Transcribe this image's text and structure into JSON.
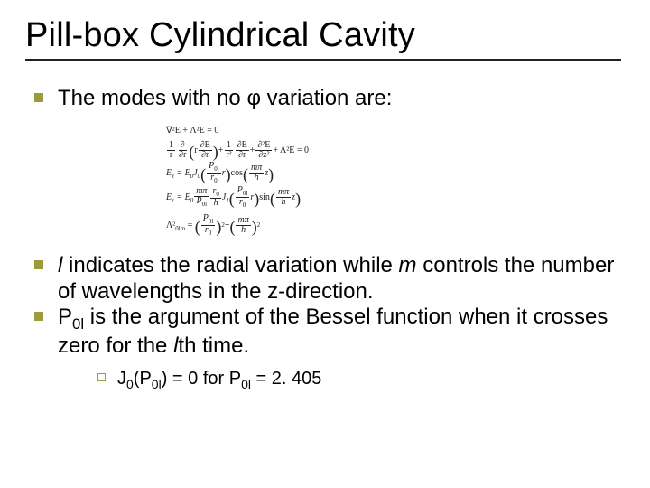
{
  "title": "Pill-box Cylindrical Cavity",
  "bullet1": "The modes with no φ variation are:",
  "equations": {
    "eq1_lhs": "∇²E + Λ²E = 0",
    "eq2": {
      "t1_num": "1",
      "t1_den": "r",
      "t2_num": "∂",
      "t2_den": "∂r",
      "t3_num": "∂E",
      "t3_den": "∂r",
      "t4_num": "1",
      "t4_den": "r²",
      "t5_num": "∂E",
      "t5_den": "∂r",
      "t6_num": "∂²E",
      "t6_den": "∂z²",
      "tail": "+ Λ²E = 0",
      "r_inside": "r"
    },
    "eq3": {
      "lhs": "E",
      "lhs_sub": "z",
      "coef": "= E",
      "coef_sub": "0",
      "J": "J",
      "J_sub": "0",
      "arg1_num": "P",
      "arg1_num_sub": "0l",
      "arg1_den": "r",
      "arg1_den_sub": "0",
      "r_after": "r",
      "trig": "cos",
      "arg2_num": "mπ",
      "arg2_den": "h",
      "z_after": "z"
    },
    "eq4": {
      "lhs": "E",
      "lhs_sub": "r",
      "eqs": "= E",
      "eqs_sub": "0",
      "f1_num": "mπ",
      "f1_den_a": "P",
      "f1_den_a_sub": "0l",
      "f2_num": "r",
      "f2_num_sub": "0",
      "f2_den": "h",
      "J": "J",
      "J_sub": "1",
      "arg1_num": "P",
      "arg1_num_sub": "0l",
      "arg1_den": "r",
      "arg1_den_sub": "0",
      "r_after": "r",
      "trig": "sin",
      "arg2_num": "mπ",
      "arg2_den": "h",
      "z_after": "z"
    },
    "eq5": {
      "lhs": "Λ²",
      "lhs_sub": "0lm",
      "eqs": "=",
      "t1_num": "P",
      "t1_num_sub": "0l",
      "t1_den": "r",
      "t1_den_sub": "0",
      "plus": "+",
      "t2_num": "mπ",
      "t2_den": "h",
      "sq": "2"
    }
  },
  "bullet2_a": "l",
  "bullet2_b": " indicates the radial variation while ",
  "bullet2_c": "m",
  "bullet2_d": " controls the number of wavelengths in the z-direction.",
  "bullet3_a": "P",
  "bullet3_a_sub": "0l",
  "bullet3_b": " is the argument of the Bessel function when it crosses zero for the ",
  "bullet3_c": "l",
  "bullet3_d": "th time.",
  "sub1_a": "J",
  "sub1_a_sub": "0",
  "sub1_b": "(P",
  "sub1_b_sub": "0l",
  "sub1_c": ") = 0 for P",
  "sub1_c_sub": "0l",
  "sub1_d": " = 2. 405"
}
